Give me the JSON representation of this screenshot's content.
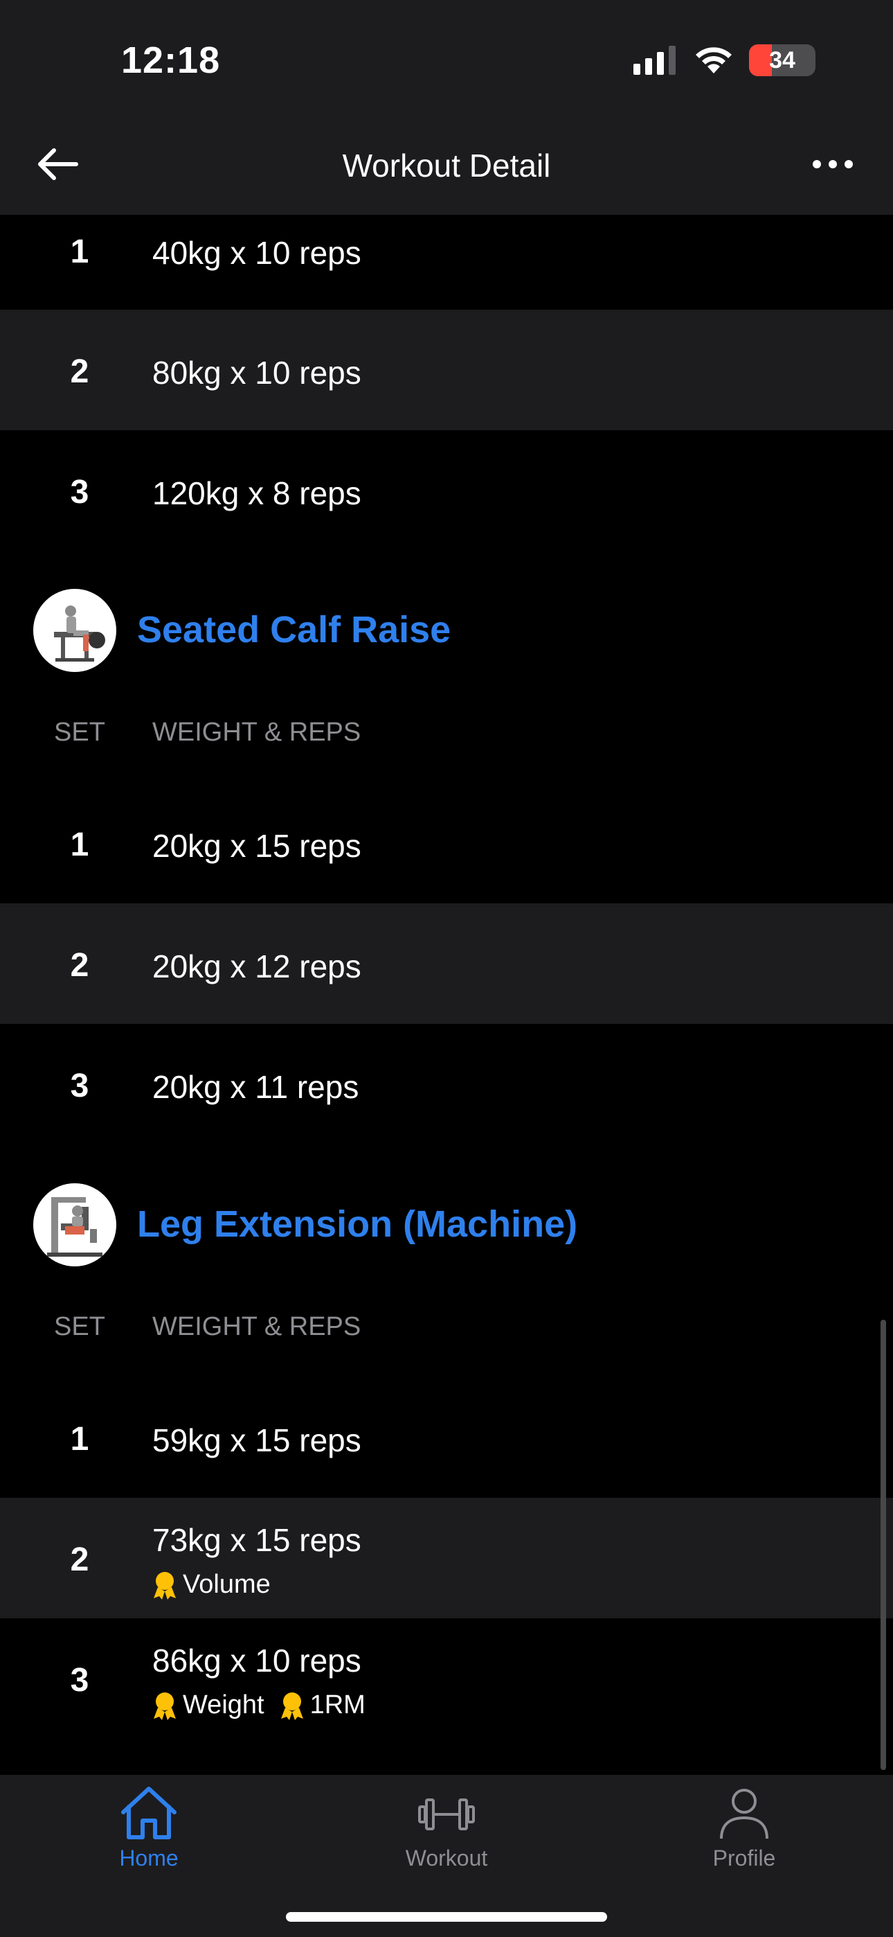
{
  "status_bar": {
    "time": "12:18",
    "battery_level": "34",
    "battery_fraction": 0.34,
    "battery_color": "#ff453a",
    "icons": [
      "signal-icon",
      "wifi-icon",
      "battery-charging-icon"
    ]
  },
  "nav": {
    "title": "Workout Detail",
    "back_icon": "arrow-left-icon",
    "more_icon": "ellipsis-icon"
  },
  "accent_color": "#2f80ed",
  "medal_color": "#ffc107",
  "previous_exercise": {
    "sets": [
      {
        "set": "1",
        "reps": "40kg x 10 reps"
      },
      {
        "set": "2",
        "reps": "80kg x 10 reps"
      },
      {
        "set": "3",
        "reps": "120kg x 8 reps"
      }
    ]
  },
  "exercises": [
    {
      "name": "Seated Calf Raise",
      "col_set": "SET",
      "col_weight_reps": "WEIGHT & REPS",
      "sets": [
        {
          "set": "1",
          "reps": "20kg x 15 reps"
        },
        {
          "set": "2",
          "reps": "20kg x 12 reps"
        },
        {
          "set": "3",
          "reps": "20kg x 11 reps"
        }
      ]
    },
    {
      "name": "Leg Extension (Machine)",
      "col_set": "SET",
      "col_weight_reps": "WEIGHT & REPS",
      "sets": [
        {
          "set": "1",
          "reps": "59kg x 15 reps"
        },
        {
          "set": "2",
          "reps": "73kg x 15 reps",
          "badges": [
            "Volume"
          ]
        },
        {
          "set": "3",
          "reps": "86kg x 10 reps",
          "badges": [
            "Weight",
            "1RM"
          ]
        }
      ]
    }
  ],
  "tabs": [
    {
      "label": "Home",
      "icon": "home-icon",
      "active": true
    },
    {
      "label": "Workout",
      "icon": "dumbbell-icon",
      "active": false
    },
    {
      "label": "Profile",
      "icon": "person-icon",
      "active": false
    }
  ]
}
